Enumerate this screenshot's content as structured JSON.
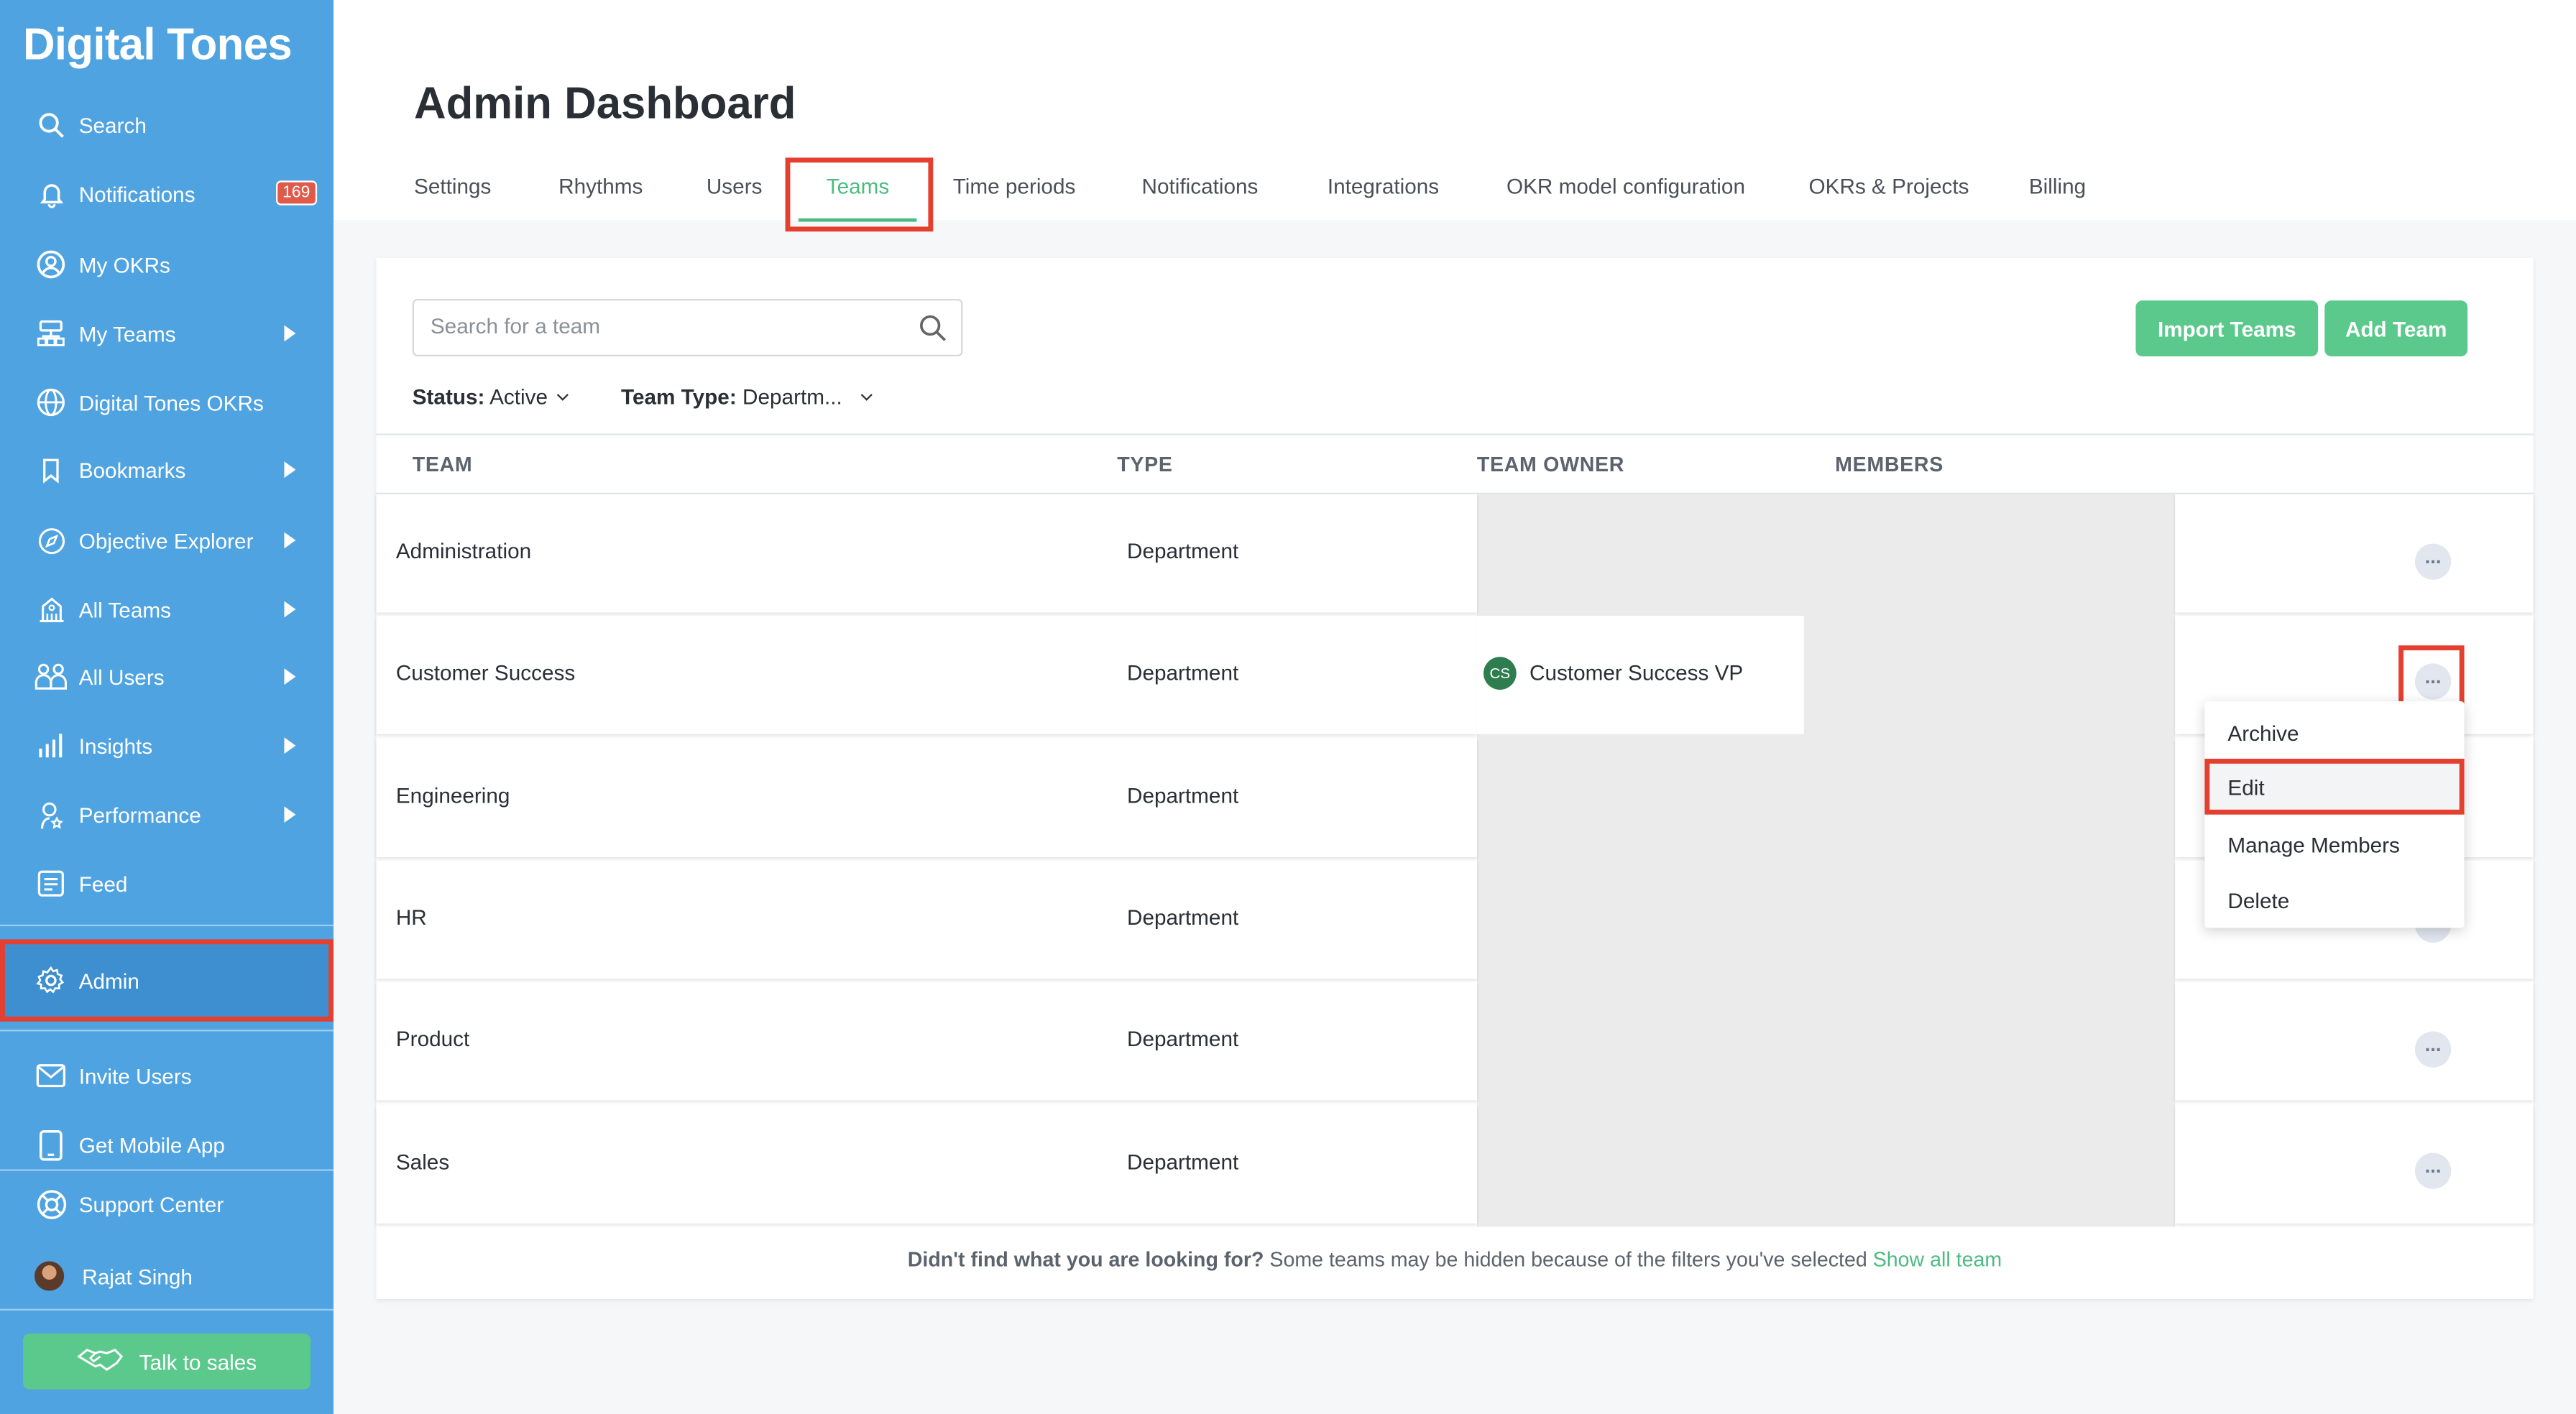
{
  "sidebar": {
    "logo": "Digital Tones",
    "items": [
      {
        "label": "Search",
        "icon": "search-icon"
      },
      {
        "label": "Notifications",
        "icon": "bell-icon",
        "badge": "169"
      },
      {
        "label": "My OKRs",
        "icon": "user-circle-icon"
      },
      {
        "label": "My Teams",
        "icon": "org-chart-icon"
      },
      {
        "label": "Digital Tones OKRs",
        "icon": "globe-icon"
      },
      {
        "label": "Bookmarks",
        "icon": "bookmark-icon"
      },
      {
        "label": "Objective Explorer",
        "icon": "compass-icon"
      },
      {
        "label": "All Teams",
        "icon": "building-icon"
      },
      {
        "label": "All Users",
        "icon": "users-icon"
      },
      {
        "label": "Insights",
        "icon": "bar-chart-icon"
      },
      {
        "label": "Performance",
        "icon": "person-star-icon"
      },
      {
        "label": "Feed",
        "icon": "feed-icon"
      },
      {
        "label": "Admin",
        "icon": "gear-icon"
      },
      {
        "label": "Invite Users",
        "icon": "mail-icon"
      },
      {
        "label": "Get Mobile App",
        "icon": "mobile-icon"
      },
      {
        "label": "Support Center",
        "icon": "lifebuoy-icon"
      },
      {
        "label": "Rajat Singh",
        "icon": "avatar"
      }
    ],
    "talk_to_sales": "Talk to sales"
  },
  "header": {
    "title": "Admin Dashboard",
    "tabs": [
      "Settings",
      "Rhythms",
      "Users",
      "Teams",
      "Time periods",
      "Notifications",
      "Integrations",
      "OKR model configuration",
      "OKRs & Projects",
      "Billing"
    ],
    "active_tab": "Teams"
  },
  "toolbar": {
    "search_placeholder": "Search for a team",
    "import_label": "Import Teams",
    "add_label": "Add Team",
    "status_label": "Status:",
    "status_value": "Active",
    "type_label": "Team Type:",
    "type_value": "Departm..."
  },
  "table": {
    "columns": [
      "TEAM",
      "TYPE",
      "TEAM OWNER",
      "MEMBERS"
    ],
    "rows": [
      {
        "team": "Administration",
        "type": "Department",
        "owner": "",
        "owner_initials": ""
      },
      {
        "team": "Customer Success",
        "type": "Department",
        "owner": "Customer Success VP",
        "owner_initials": "CS"
      },
      {
        "team": "Engineering",
        "type": "Department",
        "owner": "",
        "owner_initials": ""
      },
      {
        "team": "HR",
        "type": "Department",
        "owner": "",
        "owner_initials": ""
      },
      {
        "team": "Product",
        "type": "Department",
        "owner": "",
        "owner_initials": ""
      },
      {
        "team": "Sales",
        "type": "Department",
        "owner": "",
        "owner_initials": ""
      }
    ],
    "more_symbol": "..."
  },
  "context_menu": {
    "items": [
      "Archive",
      "Edit",
      "Manage Members",
      "Delete"
    ],
    "highlighted": "Edit"
  },
  "footer": {
    "question": "Didn't find what you are looking for?",
    "note": "Some teams may be hidden because of the filters you've selected",
    "link": "Show all team"
  },
  "colors": {
    "sidebar": "#4fa3e0",
    "accent_green": "#5bc98c",
    "highlight_red": "#e5402f",
    "badge_red": "#e05a4b"
  }
}
